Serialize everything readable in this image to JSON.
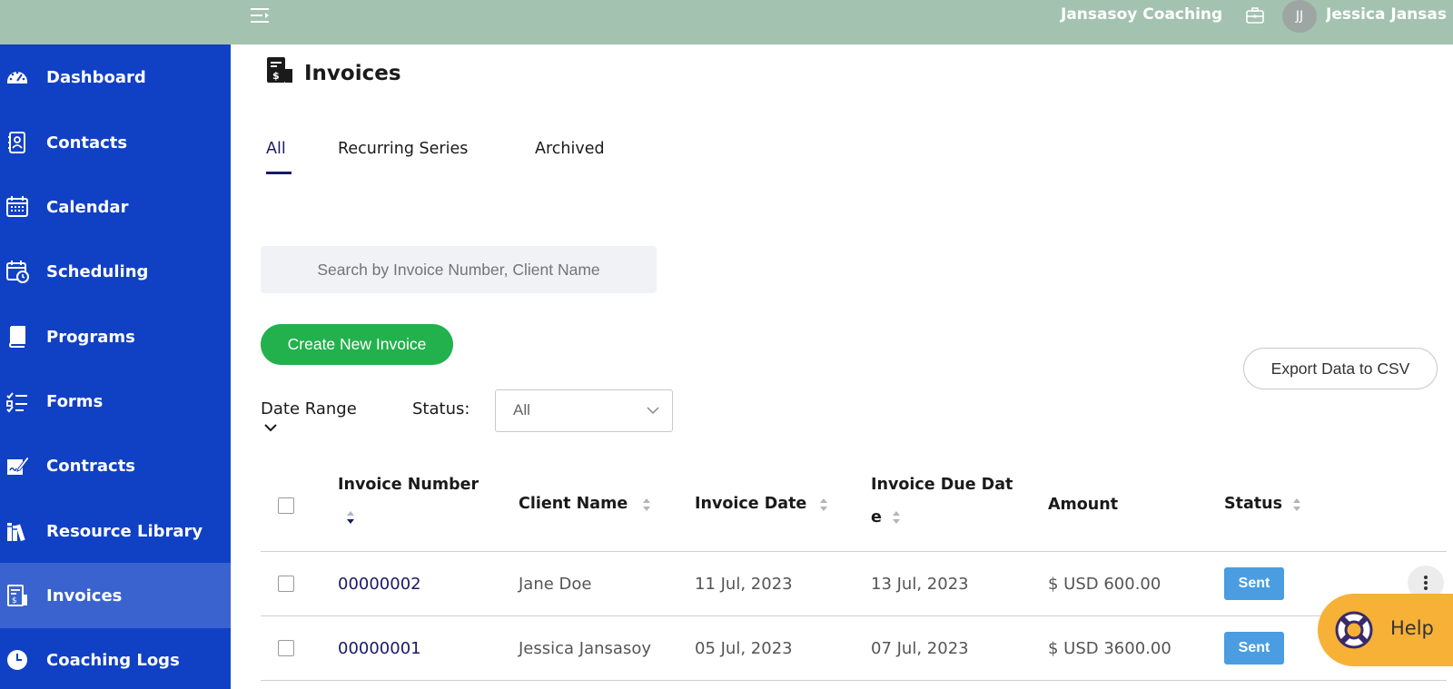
{
  "header": {
    "company": "Jansasoy Coaching",
    "avatar_initials": "JJ",
    "user_name": "Jessica Jansas",
    "bg_color": "#a3c2b0"
  },
  "sidebar": {
    "bg_color": "#1040c4",
    "active_color": "#3a63cf",
    "items": [
      {
        "label": "Dashboard",
        "icon": "dashboard-gauge-icon"
      },
      {
        "label": "Contacts",
        "icon": "contacts-book-icon"
      },
      {
        "label": "Calendar",
        "icon": "calendar-icon"
      },
      {
        "label": "Scheduling",
        "icon": "scheduling-clock-icon"
      },
      {
        "label": "Programs",
        "icon": "book-icon"
      },
      {
        "label": "Forms",
        "icon": "checklist-icon"
      },
      {
        "label": "Contracts",
        "icon": "signature-icon"
      },
      {
        "label": "Resource Library",
        "icon": "library-books-icon"
      },
      {
        "label": "Invoices",
        "icon": "invoice-icon",
        "active": true
      },
      {
        "label": "Coaching Logs",
        "icon": "clock-icon"
      }
    ]
  },
  "page": {
    "title": "Invoices",
    "tabs": [
      {
        "label": "All",
        "active": true
      },
      {
        "label": "Recurring Series"
      },
      {
        "label": "Archived"
      }
    ],
    "search_placeholder": "Search by Invoice Number, Client Name",
    "create_button": "Create New Invoice",
    "export_button": "Export Data to CSV",
    "filters": {
      "date_range_label": "Date Range",
      "status_label": "Status:",
      "status_value": "All"
    }
  },
  "table": {
    "columns": {
      "invoice_number": "Invoice Number",
      "client_name": "Client Name",
      "invoice_date": "Invoice Date",
      "due_date_line1": "Invoice Due Dat",
      "due_date_line2": "e",
      "amount": "Amount",
      "status": "Status"
    },
    "rows": [
      {
        "invoice_number": "00000002",
        "client": "Jane Doe",
        "date": "11 Jul, 2023",
        "due": "13 Jul, 2023",
        "amount": "$ USD 600.00",
        "status": "Sent"
      },
      {
        "invoice_number": "00000001",
        "client": "Jessica Jansasoy",
        "date": "05 Jul, 2023",
        "due": "07 Jul, 2023",
        "amount": "$ USD 3600.00",
        "status": "Sent"
      }
    ]
  },
  "help": {
    "label": "Help",
    "color": "#f7b137"
  },
  "colors": {
    "accent_green": "#22b14c",
    "badge_blue": "#4a9de0",
    "link_navy": "#1a1a66"
  }
}
